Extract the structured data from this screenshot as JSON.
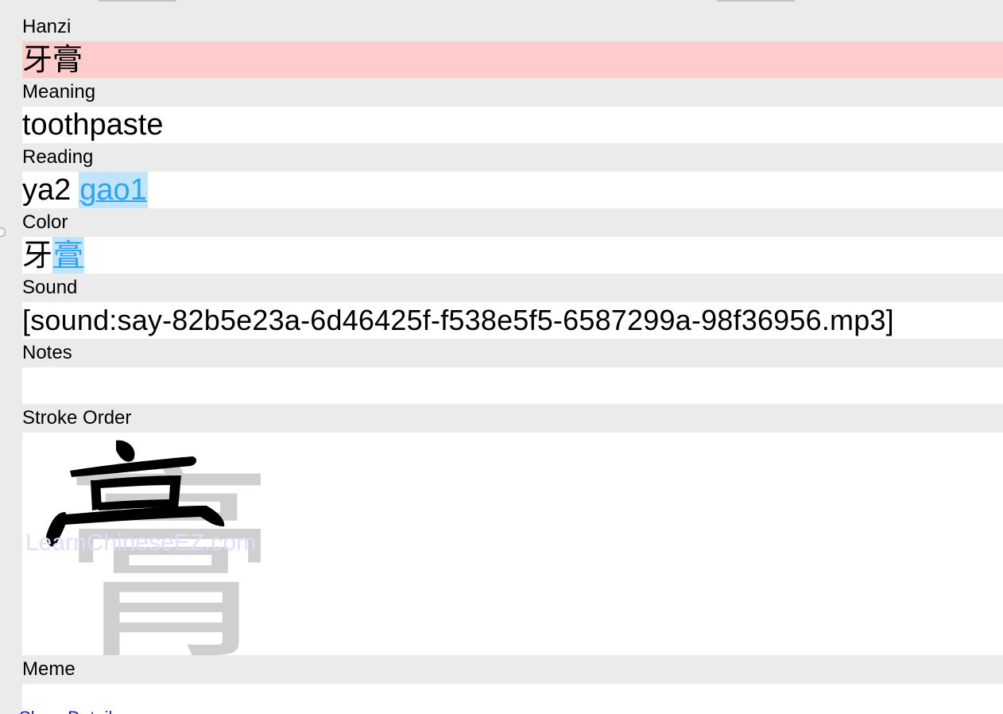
{
  "fields": {
    "hanzi": {
      "label": "Hanzi",
      "value": "牙膏"
    },
    "meaning": {
      "label": "Meaning",
      "value": "toothpaste"
    },
    "reading": {
      "label": "Reading",
      "syllable1": "ya2",
      "syllable2": "gao1"
    },
    "color": {
      "label": "Color",
      "char1": "牙",
      "char2": "膏"
    },
    "sound": {
      "label": "Sound",
      "value": "[sound:say-82b5e23a-6d46425f-f538e5f5-6587299a-98f36956.mp3]"
    },
    "notes": {
      "label": "Notes",
      "value": ""
    },
    "stroke_order": {
      "label": "Stroke Order",
      "character": "膏",
      "watermark": "LearnChineseEZ.com"
    },
    "meme": {
      "label": "Meme",
      "value": ""
    }
  },
  "footer": {
    "link_label": "Show Details"
  },
  "colors": {
    "hanzi_bg": "#ffcccc",
    "link_blue": "#2ea3ee",
    "link_highlight": "#bfe4fb",
    "label_bg": "#ebebeb",
    "value_bg": "#ffffff"
  },
  "icons": {
    "side_handle": "circle-handle-icon"
  }
}
